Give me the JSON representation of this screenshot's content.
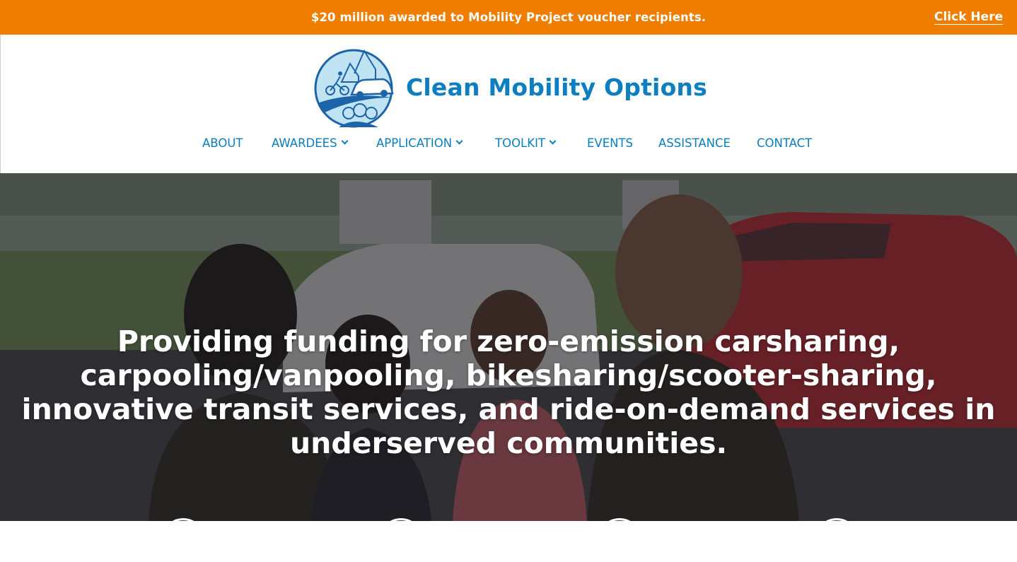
{
  "banner": {
    "message": "$20 million awarded to Mobility Project voucher recipients.",
    "link": "Click Here",
    "color": "#ee7d00"
  },
  "brand": {
    "name": "Clean Mobility Options",
    "logo_icon": "cmo-logo-icon",
    "color": "#0d7ec0"
  },
  "nav": {
    "items": [
      {
        "label": "ABOUT",
        "dropdown": false
      },
      {
        "label": "AWARDEES",
        "dropdown": true
      },
      {
        "label": "APPLICATION",
        "dropdown": true
      },
      {
        "label": "TOOLKIT",
        "dropdown": true
      },
      {
        "label": "EVENTS",
        "dropdown": false
      },
      {
        "label": "ASSISTANCE",
        "dropdown": false
      },
      {
        "label": "CONTACT",
        "dropdown": false
      }
    ]
  },
  "hero": {
    "text": "Providing funding for zero-emission carsharing, carpooling/vanpooling, bikesharing/scooter-sharing, innovative transit services, and ride-on-demand services in underserved communities."
  }
}
